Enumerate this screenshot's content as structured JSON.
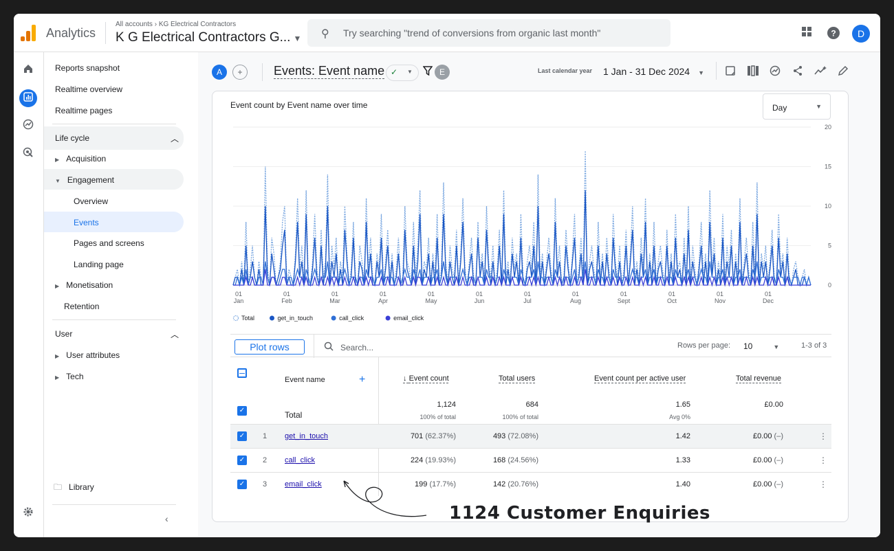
{
  "topbar": {
    "brand": "Analytics",
    "crumb_root": "All accounts",
    "crumb_account": "KG Electrical Contractors",
    "property": "K G Electrical Contractors G...",
    "search_placeholder": "Try searching \"trend of conversions from organic last month\"",
    "avatar": "D",
    "logo_colors": [
      "#f9ab00",
      "#e37400",
      "#e37400"
    ]
  },
  "nav": {
    "reports_snapshot": "Reports snapshot",
    "realtime_overview": "Realtime overview",
    "realtime_pages": "Realtime pages",
    "lifecycle": "Life cycle",
    "acquisition": "Acquisition",
    "engagement": "Engagement",
    "overview": "Overview",
    "events": "Events",
    "pages_screens": "Pages and screens",
    "landing_page": "Landing page",
    "monetisation": "Monetisation",
    "retention": "Retention",
    "user": "User",
    "user_attributes": "User attributes",
    "tech": "Tech",
    "library": "Library"
  },
  "header": {
    "chip_a": "A",
    "title": "Events: Event name",
    "chip_e": "E",
    "range_label": "Last calendar year",
    "range": "1 Jan - 31 Dec 2024"
  },
  "chart_card": {
    "title": "Event count by Event name over time",
    "granularity": "Day"
  },
  "chart_data": {
    "type": "line",
    "title": "Event count by Event name over time",
    "x_ticks": [
      [
        "01",
        "Jan"
      ],
      [
        "01",
        "Feb"
      ],
      [
        "01",
        "Mar"
      ],
      [
        "01",
        "Apr"
      ],
      [
        "01",
        "May"
      ],
      [
        "01",
        "Jun"
      ],
      [
        "01",
        "Jul"
      ],
      [
        "01",
        "Aug"
      ],
      [
        "01",
        "Sept"
      ],
      [
        "01",
        "Oct"
      ],
      [
        "01",
        "Nov"
      ],
      [
        "01",
        "Dec"
      ]
    ],
    "y_ticks": [
      20,
      15,
      10,
      5,
      0
    ],
    "ylim": [
      0,
      20
    ],
    "legend": [
      "Total",
      "get_in_touch",
      "call_click",
      "email_click"
    ],
    "colors": [
      "#7aa7e0",
      "#1a56c4",
      "#2f6fd6",
      "#3b3fd6"
    ],
    "series": [
      {
        "name": "Total",
        "style": "dashed",
        "values": [
          0,
          1,
          2,
          0,
          3,
          0,
          8,
          0,
          2,
          5,
          1,
          0,
          3,
          1,
          0,
          15,
          2,
          0,
          6,
          4,
          0,
          1,
          3,
          8,
          10,
          0,
          2,
          1,
          0,
          4,
          11,
          2,
          5,
          0,
          12,
          1,
          0,
          3,
          9,
          2,
          0,
          7,
          1,
          3,
          14,
          0,
          5,
          2,
          6,
          0,
          3,
          1,
          10,
          4,
          0,
          2,
          8,
          1,
          0,
          5,
          3,
          0,
          11,
          2,
          6,
          1,
          0,
          4,
          2,
          9,
          0,
          3,
          7,
          1,
          4,
          0,
          2,
          6,
          0,
          1,
          10,
          3,
          2,
          0,
          8,
          1,
          5,
          12,
          0,
          3,
          2,
          6,
          0,
          4,
          1,
          9,
          0,
          2,
          13,
          3,
          0,
          5,
          2,
          1,
          7,
          0,
          4,
          11,
          2,
          0,
          3,
          6,
          1,
          0,
          8,
          2,
          4,
          0,
          10,
          3,
          1,
          5,
          0,
          2,
          7,
          0,
          12,
          1,
          3,
          0,
          6,
          2,
          4,
          0,
          9,
          1,
          0,
          3,
          5,
          2,
          8,
          0,
          14,
          1,
          4,
          0,
          3,
          6,
          2,
          0,
          11,
          2,
          5,
          0,
          1,
          7,
          3,
          0,
          4,
          9,
          0,
          2,
          6,
          1,
          17,
          0,
          3,
          5,
          2,
          0,
          8,
          1,
          4,
          0,
          6,
          2,
          0,
          9,
          3,
          1,
          5,
          0,
          2,
          7,
          0,
          4,
          10,
          1,
          3,
          0,
          6,
          2,
          11,
          0,
          4,
          1,
          8,
          0,
          3,
          5,
          2,
          0,
          7,
          1,
          4,
          0,
          9,
          2,
          3,
          0,
          6,
          1,
          10,
          0,
          5,
          2,
          0,
          3,
          8,
          1,
          4,
          0,
          12,
          2,
          6,
          0,
          3,
          1,
          9,
          0,
          5,
          2,
          7,
          0,
          4,
          1,
          11,
          0,
          3,
          6,
          2,
          0,
          8,
          1,
          13,
          0,
          4,
          2,
          5,
          0,
          3,
          7,
          1,
          0,
          9,
          2,
          4,
          0,
          6,
          1,
          0,
          2,
          3,
          1,
          0,
          1,
          2,
          0,
          1,
          0
        ]
      },
      {
        "name": "get_in_touch",
        "style": "solid",
        "values": [
          0,
          1,
          1,
          0,
          2,
          0,
          5,
          0,
          1,
          3,
          1,
          0,
          2,
          0,
          0,
          10,
          1,
          0,
          4,
          2,
          0,
          1,
          2,
          5,
          7,
          0,
          1,
          0,
          0,
          3,
          8,
          1,
          3,
          0,
          9,
          0,
          0,
          2,
          6,
          1,
          0,
          5,
          0,
          2,
          10,
          0,
          3,
          1,
          4,
          0,
          2,
          0,
          7,
          3,
          0,
          1,
          6,
          0,
          0,
          3,
          2,
          0,
          8,
          1,
          4,
          0,
          0,
          3,
          1,
          6,
          0,
          2,
          5,
          0,
          3,
          0,
          1,
          4,
          0,
          0,
          7,
          2,
          1,
          0,
          5,
          0,
          3,
          9,
          0,
          2,
          1,
          4,
          0,
          3,
          0,
          6,
          0,
          1,
          9,
          2,
          0,
          3,
          1,
          0,
          5,
          0,
          3,
          8,
          1,
          0,
          2,
          4,
          0,
          0,
          6,
          1,
          3,
          0,
          7,
          2,
          0,
          3,
          0,
          1,
          5,
          0,
          9,
          0,
          2,
          0,
          4,
          1,
          3,
          0,
          6,
          0,
          0,
          2,
          3,
          1,
          5,
          0,
          10,
          0,
          3,
          0,
          2,
          4,
          1,
          0,
          8,
          1,
          3,
          0,
          0,
          5,
          2,
          0,
          3,
          6,
          0,
          1,
          4,
          0,
          12,
          0,
          2,
          3,
          1,
          0,
          5,
          0,
          3,
          0,
          4,
          1,
          0,
          6,
          2,
          0,
          3,
          0,
          1,
          5,
          0,
          3,
          7,
          0,
          2,
          0,
          4,
          1,
          8,
          0,
          3,
          0,
          5,
          0,
          2,
          3,
          1,
          0,
          5,
          0,
          3,
          0,
          6,
          1,
          2,
          0,
          4,
          0,
          7,
          0,
          3,
          1,
          0,
          2,
          5,
          0,
          3,
          0,
          8,
          1,
          4,
          0,
          2,
          0,
          6,
          0,
          3,
          1,
          5,
          0,
          3,
          0,
          8,
          0,
          2,
          4,
          1,
          0,
          5,
          0,
          9,
          0,
          3,
          1,
          3,
          0,
          2,
          5,
          0,
          0,
          6,
          1,
          3,
          0,
          4,
          0,
          0,
          1,
          2,
          0,
          0,
          0,
          1,
          0,
          0,
          0
        ]
      },
      {
        "name": "call_click",
        "style": "solid",
        "values": [
          0,
          0,
          1,
          0,
          1,
          0,
          2,
          0,
          1,
          1,
          0,
          0,
          1,
          1,
          0,
          3,
          1,
          0,
          1,
          1,
          0,
          0,
          1,
          2,
          2,
          0,
          1,
          1,
          0,
          1,
          2,
          1,
          1,
          0,
          2,
          1,
          0,
          1,
          2,
          1,
          0,
          1,
          1,
          1,
          3,
          0,
          1,
          1,
          1,
          0,
          1,
          1,
          2,
          1,
          0,
          1,
          1,
          1,
          0,
          1,
          1,
          0,
          2,
          1,
          1,
          1,
          0,
          1,
          1,
          2,
          0,
          1,
          1,
          1,
          1,
          0,
          1,
          1,
          0,
          1,
          2,
          1,
          1,
          0,
          2,
          1,
          1,
          2,
          0,
          1,
          1,
          1,
          0,
          1,
          1,
          2,
          0,
          1,
          3,
          1,
          0,
          1,
          1,
          1,
          1,
          0,
          1,
          2,
          1,
          0,
          1,
          1,
          1,
          0,
          1,
          1,
          1,
          0,
          2,
          1,
          1,
          1,
          0,
          1,
          1,
          0,
          2,
          1,
          1,
          0,
          1,
          1,
          1,
          0,
          2,
          1,
          0,
          1,
          1,
          1,
          2,
          0,
          3,
          1,
          1,
          0,
          1,
          1,
          1,
          0,
          2,
          1,
          1,
          0,
          1,
          1,
          1,
          0,
          1,
          2,
          0,
          1,
          1,
          1,
          3,
          0,
          1,
          1,
          1,
          0,
          2,
          1,
          1,
          0,
          1,
          1,
          0,
          2,
          1,
          1,
          1,
          0,
          1,
          1,
          0,
          1,
          2,
          1,
          1,
          0,
          1,
          1,
          2,
          0,
          1,
          1,
          2,
          0,
          1,
          1,
          1,
          0,
          1,
          1,
          1,
          0,
          2,
          1,
          1,
          0,
          1,
          1,
          2,
          0,
          1,
          1,
          0,
          1,
          2,
          1,
          1,
          0,
          3,
          1,
          1,
          0,
          1,
          1,
          2,
          0,
          1,
          1,
          1,
          0,
          1,
          1,
          2,
          0,
          1,
          1,
          1,
          0,
          2,
          1,
          3,
          0,
          1,
          1,
          1,
          0,
          1,
          1,
          1,
          0,
          2,
          1,
          1,
          0,
          1,
          1,
          0,
          1,
          1,
          1,
          0,
          1,
          1,
          0,
          1,
          0
        ]
      },
      {
        "name": "email_click",
        "style": "solid",
        "values": [
          0,
          0,
          0,
          0,
          0,
          0,
          1,
          0,
          0,
          1,
          0,
          0,
          0,
          0,
          0,
          2,
          0,
          0,
          1,
          1,
          0,
          0,
          0,
          1,
          1,
          0,
          0,
          0,
          0,
          0,
          1,
          0,
          1,
          0,
          1,
          0,
          0,
          0,
          1,
          0,
          0,
          1,
          0,
          0,
          1,
          0,
          1,
          0,
          1,
          0,
          0,
          0,
          1,
          0,
          0,
          0,
          1,
          0,
          0,
          1,
          0,
          0,
          1,
          0,
          1,
          0,
          0,
          0,
          0,
          1,
          0,
          0,
          1,
          0,
          0,
          0,
          0,
          1,
          0,
          0,
          1,
          0,
          0,
          0,
          1,
          0,
          1,
          1,
          0,
          0,
          0,
          1,
          0,
          0,
          0,
          1,
          0,
          0,
          1,
          0,
          0,
          1,
          0,
          0,
          1,
          0,
          0,
          1,
          0,
          0,
          0,
          1,
          0,
          0,
          1,
          0,
          0,
          0,
          1,
          0,
          0,
          1,
          0,
          0,
          1,
          0,
          1,
          0,
          0,
          0,
          1,
          0,
          0,
          0,
          1,
          0,
          0,
          0,
          1,
          0,
          1,
          0,
          1,
          0,
          0,
          0,
          0,
          1,
          0,
          0,
          1,
          0,
          1,
          0,
          0,
          1,
          0,
          0,
          0,
          1,
          0,
          0,
          1,
          0,
          2,
          0,
          0,
          1,
          0,
          0,
          1,
          0,
          0,
          0,
          1,
          0,
          0,
          1,
          0,
          0,
          1,
          0,
          0,
          1,
          0,
          0,
          1,
          0,
          0,
          0,
          1,
          0,
          1,
          0,
          0,
          0,
          1,
          0,
          0,
          1,
          0,
          0,
          1,
          0,
          0,
          0,
          1,
          0,
          0,
          0,
          1,
          0,
          1,
          0,
          1,
          0,
          0,
          0,
          1,
          0,
          0,
          0,
          1,
          0,
          1,
          0,
          0,
          0,
          1,
          0,
          1,
          0,
          1,
          0,
          0,
          0,
          1,
          0,
          0,
          1,
          0,
          0,
          1,
          0,
          1,
          0,
          0,
          0,
          1,
          0,
          0,
          1,
          0,
          0,
          1,
          0,
          0,
          0,
          1,
          0,
          0,
          0,
          0,
          0,
          0,
          0,
          0,
          0,
          0,
          0
        ]
      }
    ]
  },
  "table": {
    "plot_rows": "Plot rows",
    "search_placeholder": "Search...",
    "rows_per_page_label": "Rows per page:",
    "rows_per_page": "10",
    "pager": "1-3 of 3",
    "headers": {
      "event_name": "Event name",
      "event_count": "Event count",
      "total_users": "Total users",
      "per_active": "Event count per active user",
      "revenue": "Total revenue"
    },
    "total": {
      "label": "Total",
      "event_count": "1,124",
      "event_count_sub": "100% of total",
      "total_users": "684",
      "total_users_sub": "100% of total",
      "per_active": "1.65",
      "per_active_sub": "Avg 0%",
      "revenue": "£0.00"
    },
    "rows": [
      {
        "idx": "1",
        "name": "get_in_touch",
        "count": "701",
        "count_pct": "(62.37%)",
        "users": "493",
        "users_pct": "(72.08%)",
        "per_active": "1.42",
        "revenue": "£0.00",
        "rev_delta": "(–)"
      },
      {
        "idx": "2",
        "name": "call_click",
        "count": "224",
        "count_pct": "(19.93%)",
        "users": "168",
        "users_pct": "(24.56%)",
        "per_active": "1.33",
        "revenue": "£0.00",
        "rev_delta": "(–)"
      },
      {
        "idx": "3",
        "name": "email_click",
        "count": "199",
        "count_pct": "(17.7%)",
        "users": "142",
        "users_pct": "(20.76%)",
        "per_active": "1.40",
        "revenue": "£0.00",
        "rev_delta": "(–)"
      }
    ]
  },
  "annotation": "1124 Customer Enquiries"
}
